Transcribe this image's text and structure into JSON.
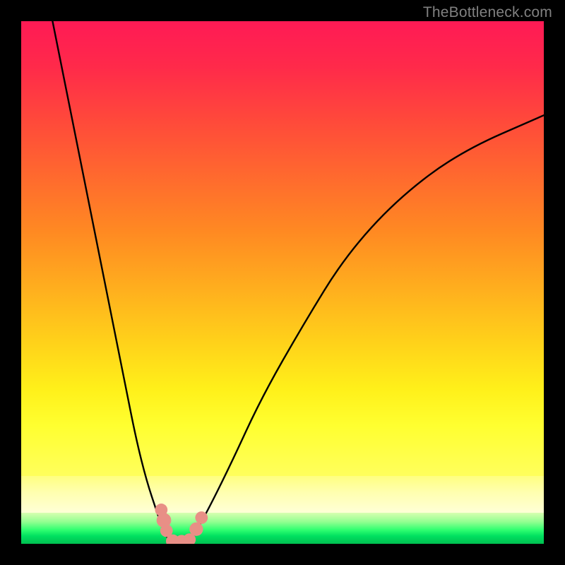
{
  "watermark": "TheBottleneck.com",
  "chart_data": {
    "type": "line",
    "title": "",
    "xlabel": "",
    "ylabel": "",
    "xlim": [
      0,
      100
    ],
    "ylim": [
      0,
      100
    ],
    "grid": false,
    "legend": false,
    "series": [
      {
        "name": "left-curve",
        "x": [
          6,
          10,
          14,
          17,
          20,
          22,
          24,
          26,
          27,
          28,
          29
        ],
        "y": [
          100,
          80,
          60,
          45,
          30,
          20,
          12,
          6,
          3,
          1,
          0
        ]
      },
      {
        "name": "right-curve",
        "x": [
          32,
          35,
          40,
          46,
          54,
          62,
          72,
          84,
          100
        ],
        "y": [
          0,
          5,
          15,
          28,
          42,
          55,
          66,
          75,
          82
        ]
      }
    ],
    "markers": [
      {
        "name": "left-cluster-top",
        "x": 26.8,
        "y": 6.5,
        "r": 1.2
      },
      {
        "name": "left-cluster-mid",
        "x": 27.3,
        "y": 4.5,
        "r": 1.4
      },
      {
        "name": "left-cluster-low",
        "x": 27.8,
        "y": 2.5,
        "r": 1.2
      },
      {
        "name": "bottom-a",
        "x": 29.0,
        "y": 0.5,
        "r": 1.3
      },
      {
        "name": "bottom-b",
        "x": 30.7,
        "y": 0.4,
        "r": 1.3
      },
      {
        "name": "bottom-c",
        "x": 32.2,
        "y": 0.8,
        "r": 1.2
      },
      {
        "name": "right-low",
        "x": 33.5,
        "y": 2.8,
        "r": 1.3
      },
      {
        "name": "right-up",
        "x": 34.5,
        "y": 5.0,
        "r": 1.2
      }
    ],
    "gradient_stops": [
      {
        "pos": 0,
        "color": "#ff1a55"
      },
      {
        "pos": 50,
        "color": "#ff8a22"
      },
      {
        "pos": 85,
        "color": "#ffff30"
      },
      {
        "pos": 95,
        "color": "#d8ffb0"
      },
      {
        "pos": 100,
        "color": "#00c050"
      }
    ]
  }
}
